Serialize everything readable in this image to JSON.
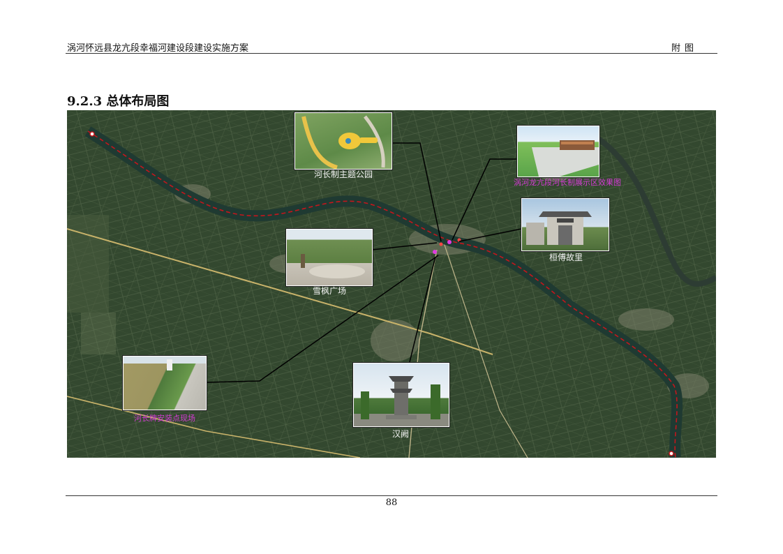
{
  "header": {
    "doc_title": "涡河怀远县龙亢段幸福河建设段建设实施方案",
    "section_label": "附图"
  },
  "section": {
    "title": "9.2.3 总体布局图"
  },
  "map": {
    "photos": [
      {
        "caption": "河长制主题公园"
      },
      {
        "caption": "涡河龙亢段河长制展示区效果图"
      },
      {
        "caption": "桓傅故里"
      },
      {
        "caption": "雪枫广场"
      },
      {
        "caption": "河长牌安装点现场"
      },
      {
        "caption": "汉阙"
      }
    ]
  },
  "footer": {
    "page_number": "88"
  }
}
